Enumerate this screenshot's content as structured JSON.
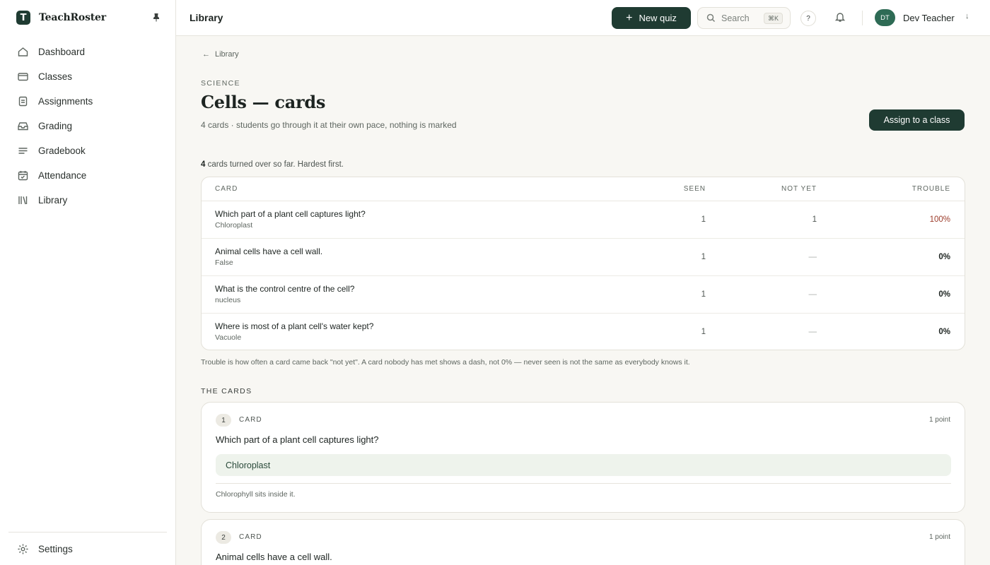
{
  "app": {
    "name": "TeachRoster",
    "logo_letter": "T"
  },
  "sidebar": {
    "items": [
      {
        "label": "Dashboard",
        "icon": "home-icon"
      },
      {
        "label": "Classes",
        "icon": "card-icon"
      },
      {
        "label": "Assignments",
        "icon": "document-icon"
      },
      {
        "label": "Grading",
        "icon": "inbox-icon"
      },
      {
        "label": "Gradebook",
        "icon": "lines-icon"
      },
      {
        "label": "Attendance",
        "icon": "calendar-icon"
      },
      {
        "label": "Library",
        "icon": "books-icon"
      }
    ],
    "settings_label": "Settings"
  },
  "topbar": {
    "title": "Library",
    "new_quiz_label": "New quiz",
    "search_placeholder": "Search",
    "search_shortcut": "⌘K",
    "help_label": "?",
    "user_initials": "DT",
    "user_name": "Dev Teacher"
  },
  "page": {
    "back_label": "Library",
    "subject": "SCIENCE",
    "title": "Cells — cards",
    "subtitle": "4 cards · students go through it at their own pace, nothing is marked",
    "assign_label": "Assign to a class"
  },
  "summary": {
    "count": "4",
    "text": " cards turned over so far. Hardest first."
  },
  "table": {
    "headers": {
      "card": "CARD",
      "seen": "SEEN",
      "not_yet": "NOT YET",
      "trouble": "TROUBLE"
    },
    "rows": [
      {
        "question": "Which part of a plant cell captures light?",
        "answer": "Chloroplast",
        "seen": "1",
        "not_yet": "1",
        "trouble": "100%"
      },
      {
        "question": "Animal cells have a cell wall.",
        "answer": "False",
        "seen": "1",
        "not_yet": "—",
        "trouble": "0%"
      },
      {
        "question": "What is the control centre of the cell?",
        "answer": "nucleus",
        "seen": "1",
        "not_yet": "—",
        "trouble": "0%"
      },
      {
        "question": "Where is most of a plant cell's water kept?",
        "answer": "Vacuole",
        "seen": "1",
        "not_yet": "—",
        "trouble": "0%"
      }
    ]
  },
  "footnote": "Trouble is how often a card came back \"not yet\". A card nobody has met shows a dash, not 0% — never seen is not the same as everybody knows it.",
  "cards_section": {
    "label": "THE CARDS",
    "cards": [
      {
        "num": "1",
        "type": "CARD",
        "points": "1 point",
        "question": "Which part of a plant cell captures light?",
        "answer": "Chloroplast",
        "note": "Chlorophyll sits inside it."
      },
      {
        "num": "2",
        "type": "CARD",
        "points": "1 point",
        "question": "Animal cells have a cell wall."
      }
    ]
  },
  "colors": {
    "primary": "#1f3b32",
    "trouble_high": "#9c3b2a",
    "answer_bg": "#eef3ec",
    "avatar": "#2e6b55"
  }
}
